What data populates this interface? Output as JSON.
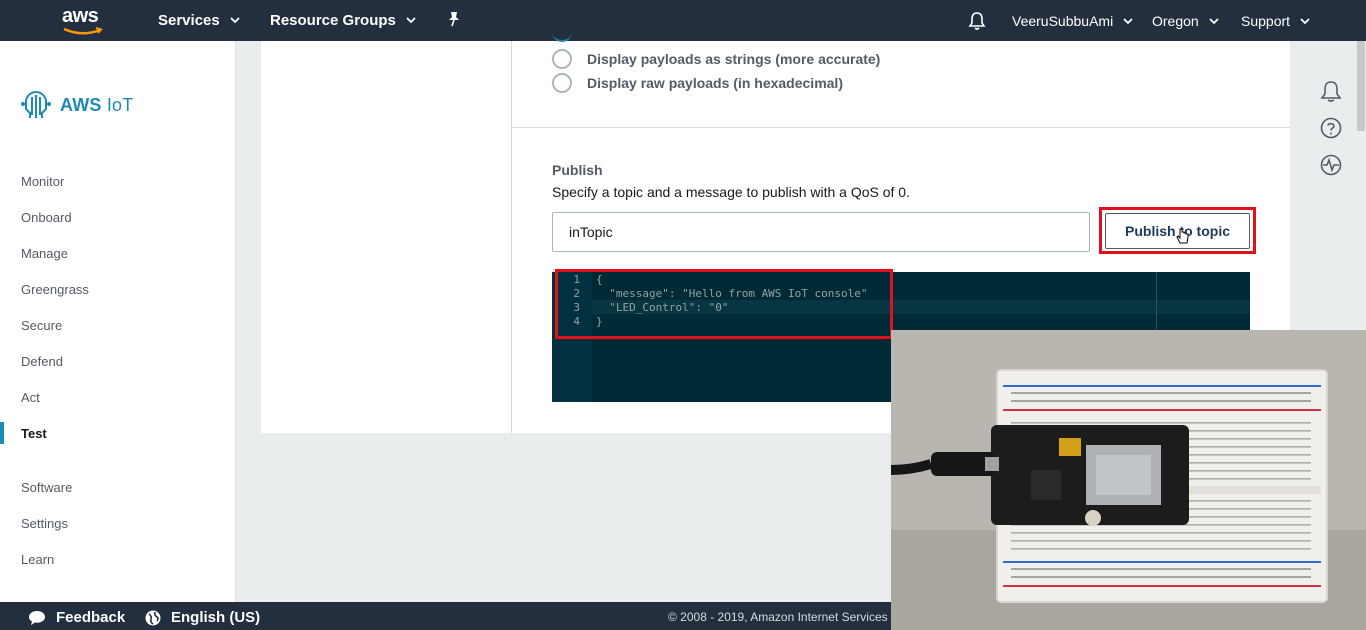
{
  "topnav": {
    "logo_text": "aws",
    "services_label": "Services",
    "resource_groups_label": "Resource Groups",
    "account_label": "VeeruSubbuAmi",
    "region_label": "Oregon",
    "support_label": "Support"
  },
  "sidebar": {
    "brand": "AWS",
    "brand_suffix": "IoT",
    "items": [
      {
        "label": "Monitor"
      },
      {
        "label": "Onboard"
      },
      {
        "label": "Manage"
      },
      {
        "label": "Greengrass"
      },
      {
        "label": "Secure"
      },
      {
        "label": "Defend"
      },
      {
        "label": "Act"
      },
      {
        "label": "Test"
      },
      {
        "label": "Software"
      },
      {
        "label": "Settings"
      },
      {
        "label": "Learn"
      }
    ],
    "active_item": "Test"
  },
  "payload_options": [
    {
      "label": "Display payloads as strings (more accurate)",
      "selected": false
    },
    {
      "label": "Display raw payloads (in hexadecimal)",
      "selected": false
    }
  ],
  "publish": {
    "title": "Publish",
    "description": "Specify a topic and a message to publish with a QoS of 0.",
    "topic_value": "inTopic",
    "button_label": "Publish to topic"
  },
  "editor": {
    "line_numbers": [
      "1",
      "2",
      "3",
      "4"
    ],
    "lines": [
      "{",
      "  \"message\": \"Hello from AWS IoT console\"",
      "  \"LED_Control\": \"0\"",
      "}"
    ]
  },
  "footer": {
    "feedback_label": "Feedback",
    "language_label": "English (US)",
    "copyright": "© 2008 - 2019, Amazon Internet Services"
  },
  "colors": {
    "nav_bg": "#232f3e",
    "accent": "#1b8bb8",
    "highlight": "#e3101b",
    "editor_bg": "#002b36"
  }
}
